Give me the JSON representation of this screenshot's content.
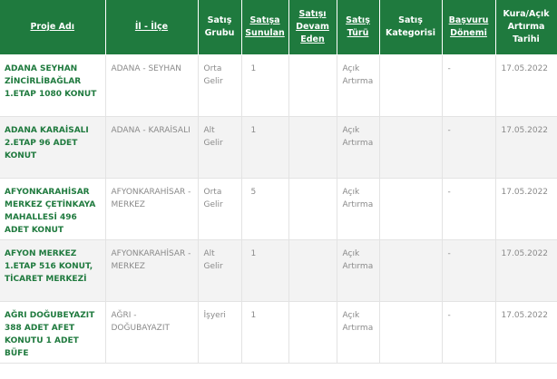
{
  "headers": {
    "proje_adi": "Proje Adı",
    "il_ilce": "İl - İlçe",
    "satis_grubu": "Satış Grubu",
    "satisa_sunulan": "Satışa Sunulan",
    "satisi_devam_eden": "Satışı Devam Eden",
    "satis_turu": "Satış Türü",
    "satis_kategorisi": "Satış Kategorisi",
    "basvuru_donemi": "Başvuru Dönemi",
    "kura_tarihi": "Kura/Açık Artırma Tarihi"
  },
  "rows": [
    {
      "proje": "ADANA SEYHAN ZİNCİRLİBAĞLAR 1.ETAP 1080 KONUT",
      "il": "ADANA - SEYHAN",
      "grup": "Orta Gelir",
      "sunulan": "1",
      "devam": "",
      "tur": "Açık Artırma",
      "kategori": "",
      "donem": "-",
      "tarih": "17.05.2022"
    },
    {
      "proje": "ADANA KARAİSALI 2.ETAP 96 ADET KONUT",
      "il": "ADANA - KARAİSALI",
      "grup": "Alt Gelir",
      "sunulan": "1",
      "devam": "",
      "tur": "Açık Artırma",
      "kategori": "",
      "donem": "-",
      "tarih": "17.05.2022"
    },
    {
      "proje": "AFYONKARAHİSAR MERKEZ ÇETİNKAYA MAHALLESİ 496 ADET KONUT",
      "il": "AFYONKARAHİSAR - MERKEZ",
      "grup": "Orta Gelir",
      "sunulan": "5",
      "devam": "",
      "tur": "Açık Artırma",
      "kategori": "",
      "donem": "-",
      "tarih": "17.05.2022"
    },
    {
      "proje": "AFYON MERKEZ 1.ETAP 516 KONUT, TİCARET MERKEZİ",
      "il": "AFYONKARAHİSAR - MERKEZ",
      "grup": "Alt Gelir",
      "sunulan": "1",
      "devam": "",
      "tur": "Açık Artırma",
      "kategori": "",
      "donem": "-",
      "tarih": "17.05.2022"
    },
    {
      "proje": "AĞRI DOĞUBEYAZIT 388 ADET AFET KONUTU 1 ADET BÜFE",
      "il": "AĞRI - DOĞUBAYAZIT",
      "grup": "İşyeri",
      "sunulan": "1",
      "devam": "",
      "tur": "Açık Artırma",
      "kategori": "",
      "donem": "-",
      "tarih": "17.05.2022"
    }
  ],
  "colors": {
    "header_bg": "#1f7a3e",
    "project_text": "#1f7a3e",
    "stripe": "#f3f3f3"
  }
}
